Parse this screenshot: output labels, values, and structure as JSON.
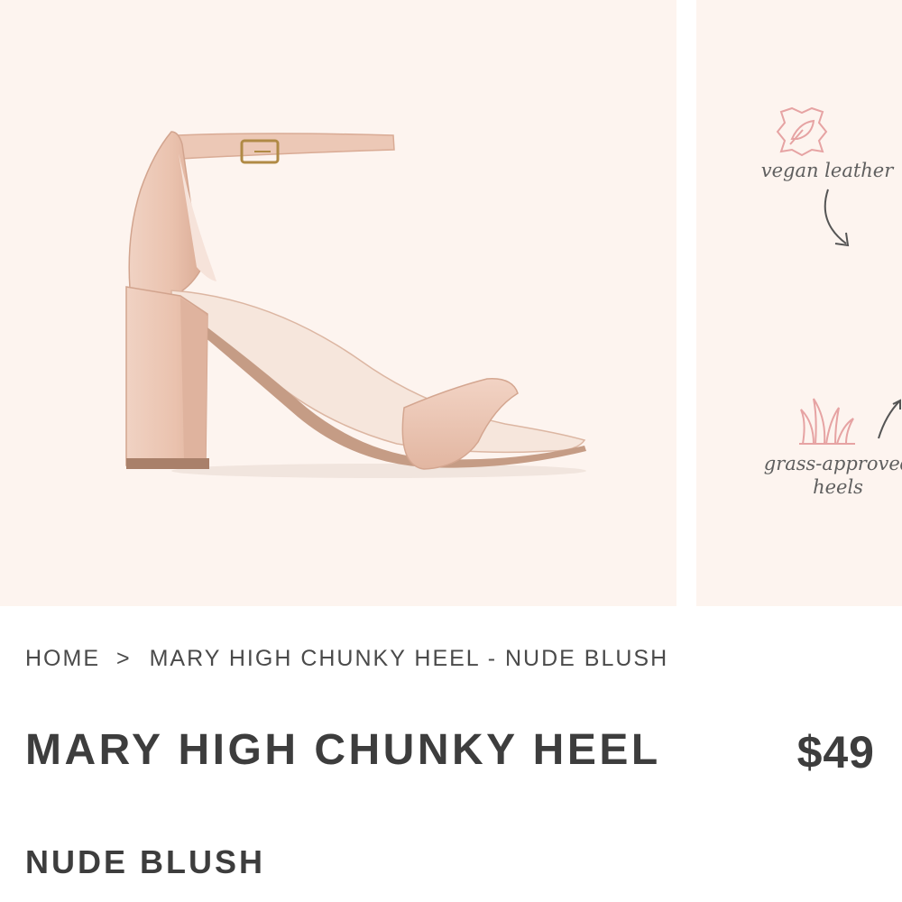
{
  "gallery": {
    "features": {
      "vegan": "vegan leather",
      "grass_line1": "grass-approved",
      "grass_line2": "heels"
    }
  },
  "breadcrumb": {
    "home": "HOME",
    "separator": ">",
    "current": "MARY HIGH CHUNKY HEEL - NUDE BLUSH"
  },
  "product": {
    "title": "MARY HIGH CHUNKY HEEL",
    "price": "$49",
    "variant": "NUDE BLUSH"
  },
  "colors": {
    "background": "#fdf4ef",
    "text": "#3d3d3d",
    "shoe": "#edc8b6",
    "icon_pink": "#e6a3a3"
  }
}
